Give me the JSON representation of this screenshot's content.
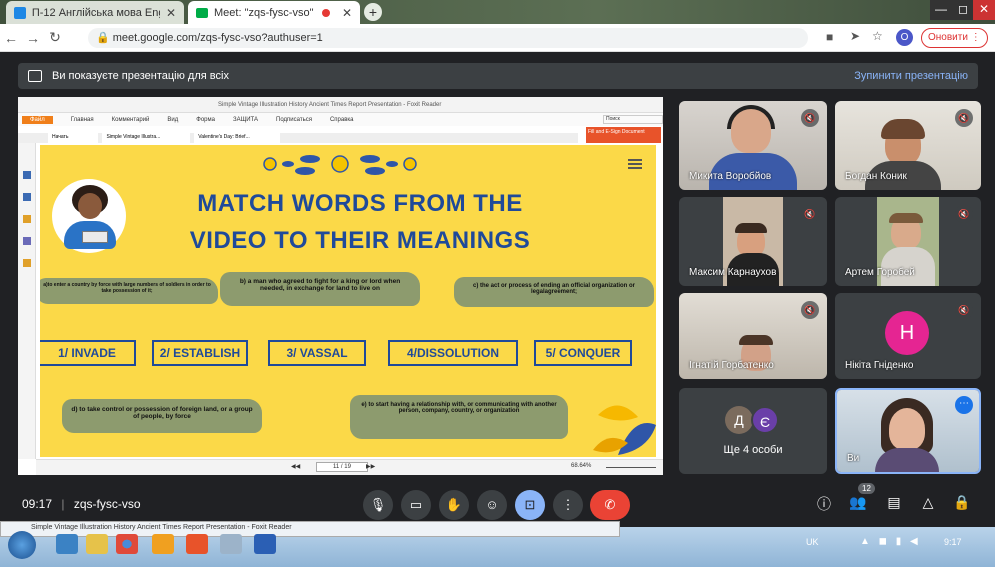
{
  "browser": {
    "tab1_title": "П-12 Англійська мова English, ...",
    "tab2_title": "Meet: \"zqs-fysc-vso\"",
    "url": "meet.google.com/zqs-fysc-vso?authuser=1",
    "update_label": "Оновити",
    "profile_initial": "O"
  },
  "meet": {
    "banner_text": "Ви показуєте презентацію для всіх",
    "stop_label": "Зупинити презентацію",
    "time": "09:17",
    "meeting_code": "zqs-fysc-vso",
    "people_badge": "12"
  },
  "reader": {
    "title": "Simple Vintage Illustration History Ancient Times Report Presentation - Foxit Reader",
    "menu": [
      "Файл",
      "Главная",
      "Комментарий",
      "Вид",
      "Форма",
      "ЗАЩИТА",
      "Подписаться",
      "Справка"
    ],
    "doc_tabs": [
      "Начать",
      "Simple Vintage Illustra...",
      "Valentine's Day: Brief..."
    ],
    "search_placeholder": "Поиск",
    "esign": "Fill and E-Sign Document",
    "page_indicator": "11 / 19",
    "zoom": "68.64%"
  },
  "slide": {
    "title_line1": "MATCH WORDS FROM THE",
    "title_line2": "VIDEO TO THEIR MEANINGS",
    "def_a": "a)to enter a country by force with large numbers of soldiers in order to take possession of it;",
    "def_b": "b) a man who agreed to fight for a king or lord when needed, in exchange for land to live on",
    "def_c": "c) the act or process of ending an official organization or legalagreement;",
    "def_d": "d) to take control or possession of foreign land, or a group of people, by force",
    "def_e": "e) to start having a relationship with, or communicating with another person, company, country, or organization",
    "words": [
      "1/ INVADE",
      "2/ ESTABLISH",
      "3/ VASSAL",
      "4/DISSOLUTION",
      "5/ CONQUER"
    ]
  },
  "participants": [
    {
      "name": "Микита Воробйов"
    },
    {
      "name": "Богдан Коник"
    },
    {
      "name": "Максим Карнаухов"
    },
    {
      "name": "Артем Горобей"
    },
    {
      "name": "Ігнатій Горбатенко"
    },
    {
      "name": "Нікіта Гніденко",
      "initial": "Н"
    },
    {
      "name": "Ще 4 особи",
      "initials": [
        "Д",
        "Є"
      ]
    },
    {
      "name": "Ви"
    }
  ],
  "taskbar": {
    "back_window_title": "Simple Vintage Illustration History Ancient Times Report Presentation - Foxit Reader",
    "lang": "UK",
    "clock": "9:17"
  },
  "colors": {
    "slide_bg": "#fbd948",
    "title_blue": "#1f4a9a",
    "brush_green": "#8d9b6e",
    "end_call": "#ea4335",
    "accent_blue": "#8ab4f8"
  }
}
